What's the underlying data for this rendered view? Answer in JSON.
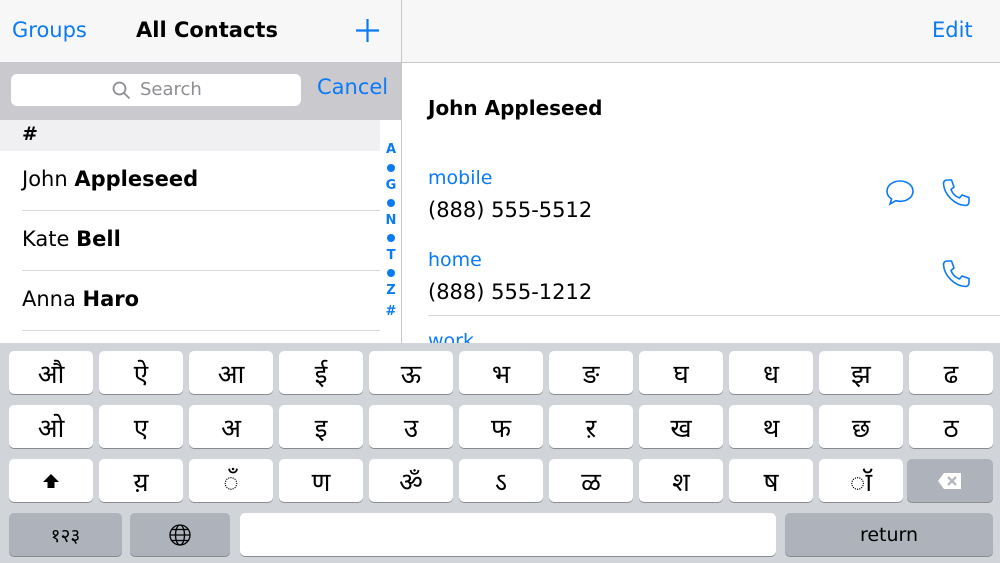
{
  "left_nav": {
    "groups": "Groups",
    "title": "All Contacts",
    "add_icon": "plus-icon"
  },
  "search": {
    "placeholder": "Search",
    "cancel": "Cancel",
    "icon": "search-icon"
  },
  "section": "#",
  "contacts": [
    {
      "first": "John",
      "last": "Appleseed"
    },
    {
      "first": "Kate",
      "last": "Bell"
    },
    {
      "first": "Anna",
      "last": "Haro"
    }
  ],
  "index": [
    "A",
    "•",
    "G",
    "•",
    "N",
    "•",
    "T",
    "•",
    "Z",
    "#"
  ],
  "right_nav": {
    "edit": "Edit"
  },
  "detail": {
    "name": "John Appleseed",
    "fields": [
      {
        "label": "mobile",
        "value": "(888) 555-5512",
        "actions": [
          "message-icon",
          "phone-icon"
        ]
      },
      {
        "label": "home",
        "value": "(888) 555-1212",
        "actions": [
          "phone-icon"
        ]
      },
      {
        "label": "work",
        "value": ""
      }
    ]
  },
  "keyboard": {
    "row1": [
      "औ",
      "ऐ",
      "आ",
      "ई",
      "ऊ",
      "भ",
      "ङ",
      "घ",
      "ध",
      "झ",
      "ढ"
    ],
    "row2": [
      "ओ",
      "ए",
      "अ",
      "इ",
      "उ",
      "फ",
      "ऱ",
      "ख",
      "थ",
      "छ",
      "ठ"
    ],
    "row3": [
      "य़",
      "ँ",
      "ण",
      "ॐ",
      "ऽ",
      "ळ",
      "श",
      "ष",
      "ॉ"
    ],
    "numbers": "१२३",
    "return": "return",
    "colors": {
      "background": "#d1d4d9",
      "key": "#ffffff",
      "dark_key": "#adb2bb"
    }
  },
  "accent_color": "#0a7af5"
}
